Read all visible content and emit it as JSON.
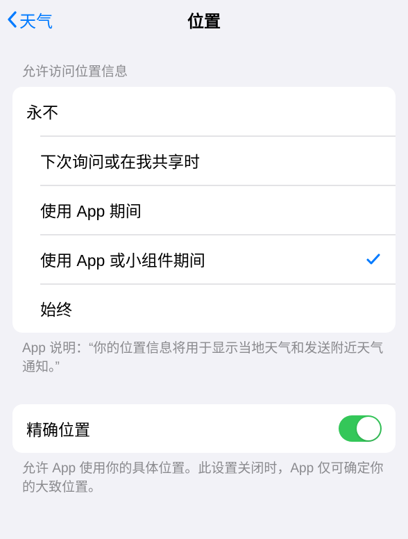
{
  "nav": {
    "back_label": "天气",
    "title": "位置"
  },
  "section1": {
    "header": "允许访问位置信息",
    "options": [
      {
        "label": "永不",
        "selected": false
      },
      {
        "label": "下次询问或在我共享时",
        "selected": false
      },
      {
        "label": "使用 App 期间",
        "selected": false
      },
      {
        "label": "使用 App 或小组件期间",
        "selected": true
      },
      {
        "label": "始终",
        "selected": false
      }
    ],
    "footer": "App 说明：“你的位置信息将用于显示当地天气和发送附近天气通知。”"
  },
  "section2": {
    "precise_label": "精确位置",
    "precise_enabled": true,
    "footer": "允许 App 使用你的具体位置。此设置关闭时，App 仅可确定你的大致位置。"
  }
}
